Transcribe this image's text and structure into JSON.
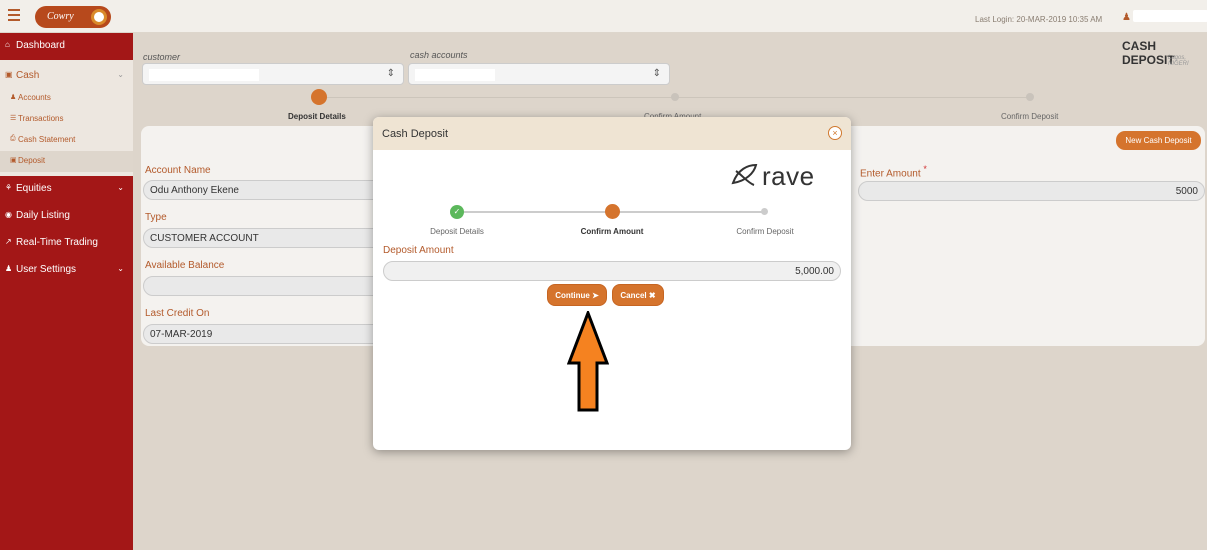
{
  "topbar": {
    "brand": "Cowry",
    "last_login": "Last Login: 20-MAR-2019 10:35 AM",
    "user_icon": "user-icon"
  },
  "sidebar": {
    "items": [
      {
        "label": "Dashboard",
        "icon": "home-icon"
      },
      {
        "label": "Cash",
        "icon": "money-icon"
      },
      {
        "label": "Equities",
        "icon": "cubes-icon"
      },
      {
        "label": "Daily Listing",
        "icon": "compass-icon"
      },
      {
        "label": "Real-Time Trading",
        "icon": "line-chart-icon"
      },
      {
        "label": "User Settings",
        "icon": "user-icon"
      }
    ],
    "cash_sub": [
      {
        "label": "Accounts"
      },
      {
        "label": "Transactions"
      },
      {
        "label": "Cash Statement"
      },
      {
        "label": "Deposit"
      }
    ]
  },
  "page": {
    "title": "CASH DEPOSIT",
    "subtitle": "Lagos, NIGERI",
    "customer_label": "customer",
    "accounts_label": "cash accounts",
    "new_button": "New Cash Deposit"
  },
  "stepper": {
    "steps": [
      "Deposit Details",
      "Confirm Amount",
      "Confirm Deposit"
    ]
  },
  "form": {
    "account_name_label": "Account Name",
    "account_name": "Odu Anthony  Ekene",
    "type_label": "Type",
    "type_value": "CUSTOMER ACCOUNT",
    "balance_label": "Available Balance",
    "balance_value": "",
    "last_credit_label": "Last Credit On",
    "last_credit_value": "07-MAR-2019",
    "enter_amount_label": "Enter Amount",
    "required_mark": "*",
    "enter_amount_value": "5000"
  },
  "modal": {
    "title": "Cash Deposit",
    "close_symbol": "×",
    "brand": "rave",
    "steps": [
      "Deposit Details",
      "Confirm Amount",
      "Confirm Deposit"
    ],
    "amount_label": "Deposit Amount",
    "amount_value": "5,000.00",
    "continue_label": "Continue",
    "cancel_label": "Cancel"
  },
  "colors": {
    "sidebar": "#a31717",
    "accent": "#d5742d",
    "success": "#5cb85c"
  }
}
